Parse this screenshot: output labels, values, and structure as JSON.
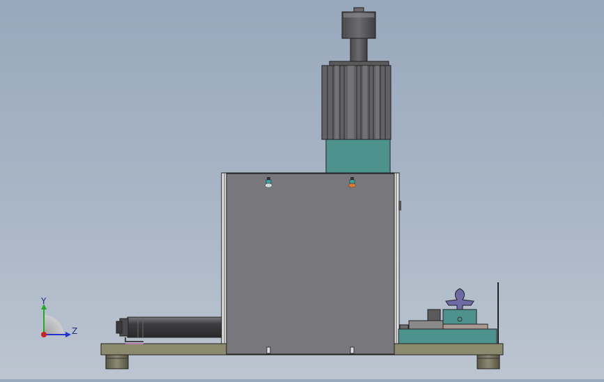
{
  "viewport": {
    "background_top": "#98a8bc",
    "background_bottom": "#bcc5d0"
  },
  "triad": {
    "y_label": "Y",
    "z_label": "Z",
    "y_color": "#22aa22",
    "z_color": "#2233cc",
    "x_color": "#cc2222"
  },
  "model": {
    "housing_color": "#78777c",
    "base_color": "#8c8a6e",
    "teal_color": "#4e928e",
    "motor_color": "#5a5a5c"
  }
}
